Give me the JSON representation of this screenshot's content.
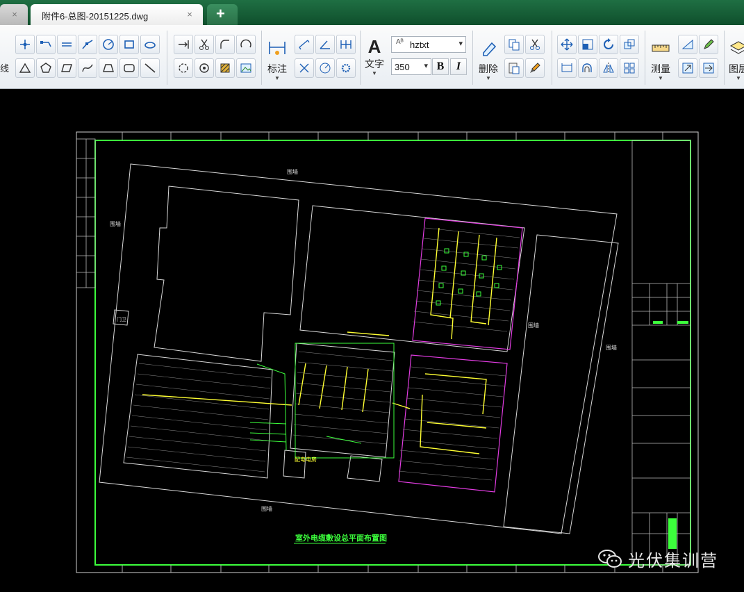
{
  "tabs": {
    "inactive_close": "×",
    "active_title": "附件6-总图-20151225.dwg",
    "active_close": "×",
    "new_tab": "+"
  },
  "ribbon": {
    "left_edge_label": "线",
    "dimension_label": "标注",
    "text_label": "文字",
    "text_icon": "A",
    "font_style": "hztxt",
    "text_height": "350",
    "bold": "B",
    "italic": "I",
    "erase_label": "删除",
    "measure_label": "测量",
    "layers_label": "图层"
  },
  "drawing": {
    "title": "室外电缆敷设总平面布置图",
    "fence_labels": [
      "围墙",
      "围墙",
      "围墙",
      "围墙",
      "围墙"
    ],
    "gate_label": "门卫",
    "power_room": "配电电房",
    "colors": {
      "frame": "#3cff3c",
      "white_lines": "#d8d8d8",
      "yellow": "#ffff33",
      "magenta": "#e23ce2",
      "green_text": "#3cff3c"
    }
  },
  "watermark": {
    "text": "光伏集训营",
    "icon": "wechat-icon"
  }
}
